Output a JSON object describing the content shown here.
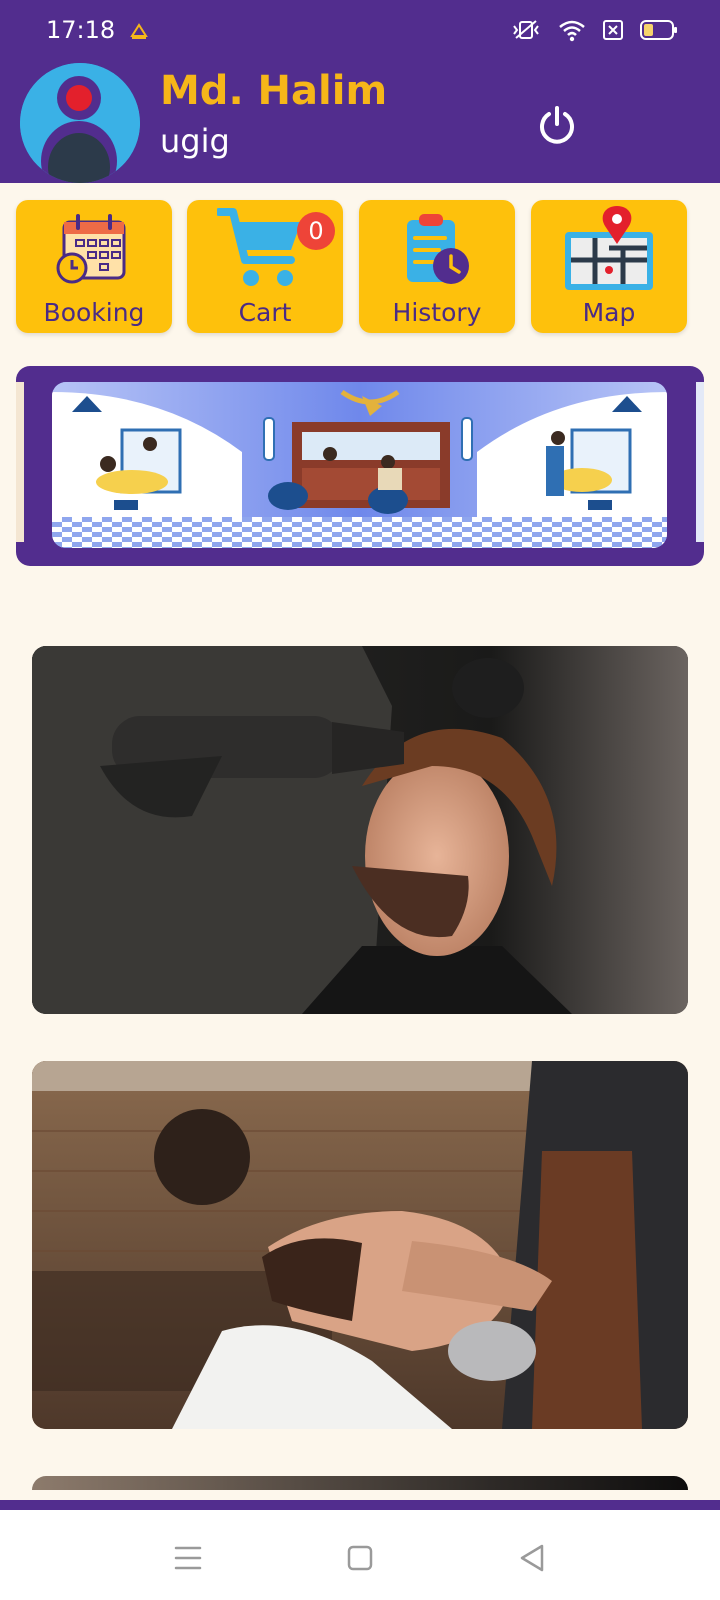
{
  "status_bar": {
    "time": "17:18",
    "icons": [
      "notification-icon",
      "vibrate-icon",
      "wifi-icon",
      "sim-off-icon",
      "battery-icon"
    ]
  },
  "header": {
    "name": "Md. Halim",
    "subtitle": "ugig",
    "power_icon": "power-icon"
  },
  "tiles": [
    {
      "label": "Booking",
      "icon": "calendar-icon"
    },
    {
      "label": "Cart",
      "icon": "cart-icon",
      "badge": "0"
    },
    {
      "label": "History",
      "icon": "history-icon"
    },
    {
      "label": "Map",
      "icon": "map-icon"
    }
  ],
  "carousel": {
    "image": "barbershop-illustration"
  },
  "photos": [
    "hair-dryer-styling-photo",
    "beard-trim-photo",
    "partial-photo"
  ],
  "nav": {
    "icons": [
      "menu-icon",
      "home-icon",
      "back-icon"
    ]
  },
  "colors": {
    "header": "#522D8E",
    "accent": "#FEC10C",
    "name": "#F6B619",
    "background": "#FDF7EC",
    "badge": "#EE4438"
  }
}
